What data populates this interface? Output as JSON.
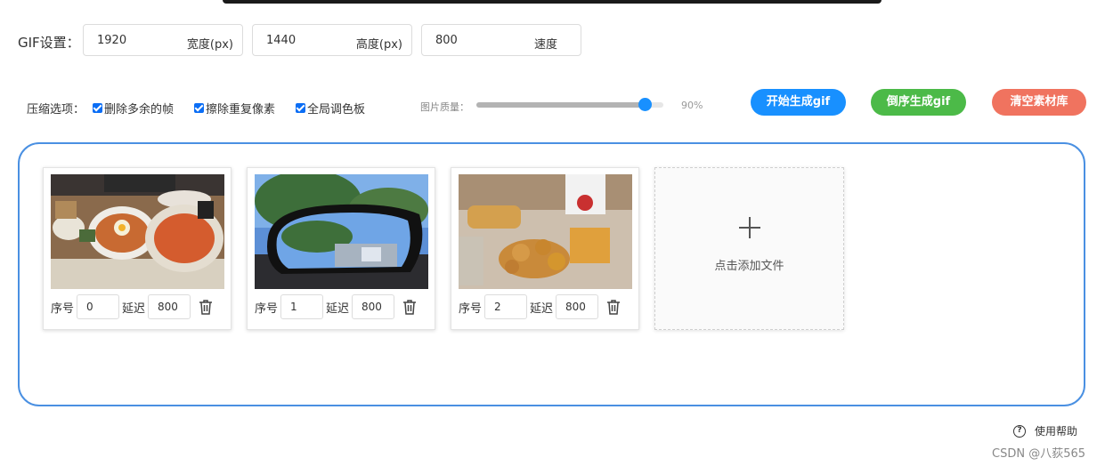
{
  "gif_settings": {
    "label": "GIF设置：",
    "width_value": "1920",
    "width_unit": "宽度(px)",
    "height_value": "1440",
    "height_unit": "高度(px)",
    "speed_value": "800",
    "speed_unit": "速度"
  },
  "compression": {
    "label": "压缩选项：",
    "options": [
      "删除多余的帧",
      "擦除重复像素",
      "全局调色板"
    ],
    "quality_label": "图片质量：",
    "quality_value": "90%",
    "quality_fraction": 0.9
  },
  "actions": {
    "start": "开始生成gif",
    "reverse": "倒序生成gif",
    "clear": "清空素材库"
  },
  "frames": [
    {
      "index_label": "序号",
      "index": "0",
      "delay_label": "延迟",
      "delay": "800",
      "image": "food-bibimbap-photo"
    },
    {
      "index_label": "序号",
      "index": "1",
      "delay_label": "延迟",
      "delay": "800",
      "image": "car-side-mirror-photo"
    },
    {
      "index_label": "序号",
      "index": "2",
      "delay_label": "延迟",
      "delay": "800",
      "image": "fried-chicken-waffle-photo"
    }
  ],
  "add_file": "点击添加文件",
  "help": "使用帮助",
  "watermark": "CSDN @八荻565",
  "colors": {
    "primary": "#1890ff",
    "green": "#4cba48",
    "red": "#f0735f",
    "border": "#4a90e2"
  }
}
